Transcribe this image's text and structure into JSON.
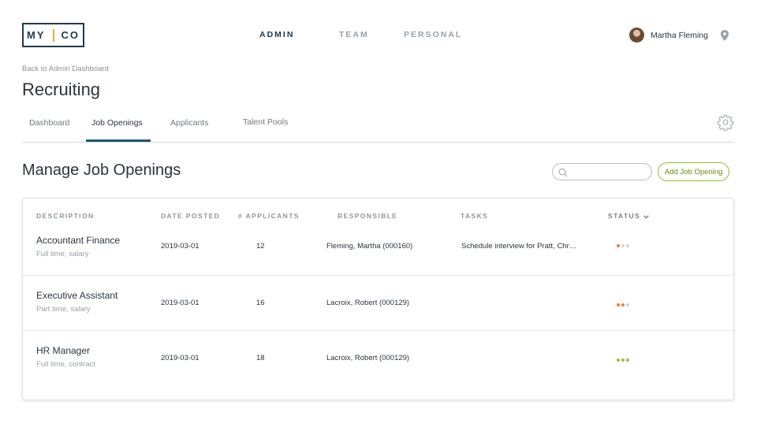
{
  "logo": {
    "left": "MY",
    "right": "CO"
  },
  "nav": {
    "items": [
      {
        "label": "ADMIN",
        "active": true
      },
      {
        "label": "TEAM",
        "active": false
      },
      {
        "label": "PERSONAL",
        "active": false
      }
    ]
  },
  "user": {
    "name": "Martha Fleming",
    "avatar_icon": "user-avatar",
    "location_icon": "map-pin-icon"
  },
  "breadcrumb": {
    "back_label": "Back to Admin Dashboard"
  },
  "page": {
    "title": "Recruiting"
  },
  "subtabs": [
    {
      "label": "Dashboard",
      "active": false
    },
    {
      "label": "Job Openings",
      "active": true
    },
    {
      "label": "Applicants",
      "active": false
    },
    {
      "label": "Talent Pools",
      "active": false
    }
  ],
  "section": {
    "title": "Manage Job Openings"
  },
  "search": {
    "placeholder": "",
    "value": "",
    "icon": "search-icon"
  },
  "actions": {
    "add_label": "Add Job Opening"
  },
  "table": {
    "headers": {
      "description": "DESCRIPTION",
      "date_posted": "DATE POSTED",
      "applicants": "# APPLICANTS",
      "responsible": "RESPONSIBLE",
      "tasks": "TASKS",
      "status": "STATUS"
    },
    "rows": [
      {
        "title": "Accountant Finance",
        "subtitle": "Full time, salary",
        "date": "2019-03-01",
        "applicants": "12",
        "responsible": "Fleming, Martha (000160)",
        "tasks": "Schedule interview for Pratt, Chr…",
        "status_level": 1
      },
      {
        "title": "Executive Assistant",
        "subtitle": "Part time, salary",
        "date": "2019-03-01",
        "applicants": "16",
        "responsible": "Lacroix, Robert (000129)",
        "tasks": "",
        "status_level": 2
      },
      {
        "title": "HR Manager",
        "subtitle": "Full time, contract",
        "date": "2019-03-01",
        "applicants": "18",
        "responsible": "Lacroix, Robert (000129)",
        "tasks": "",
        "status_level": 3
      }
    ]
  },
  "colors": {
    "brand": "#1d3a4f",
    "accent_gold": "#d8b23a",
    "tab_underline": "#1d5a73",
    "status_orange": "#f07a3a",
    "status_green": "#8cc63f",
    "status_empty": "#cfd3d7",
    "button_green": "#8cbf2a"
  }
}
